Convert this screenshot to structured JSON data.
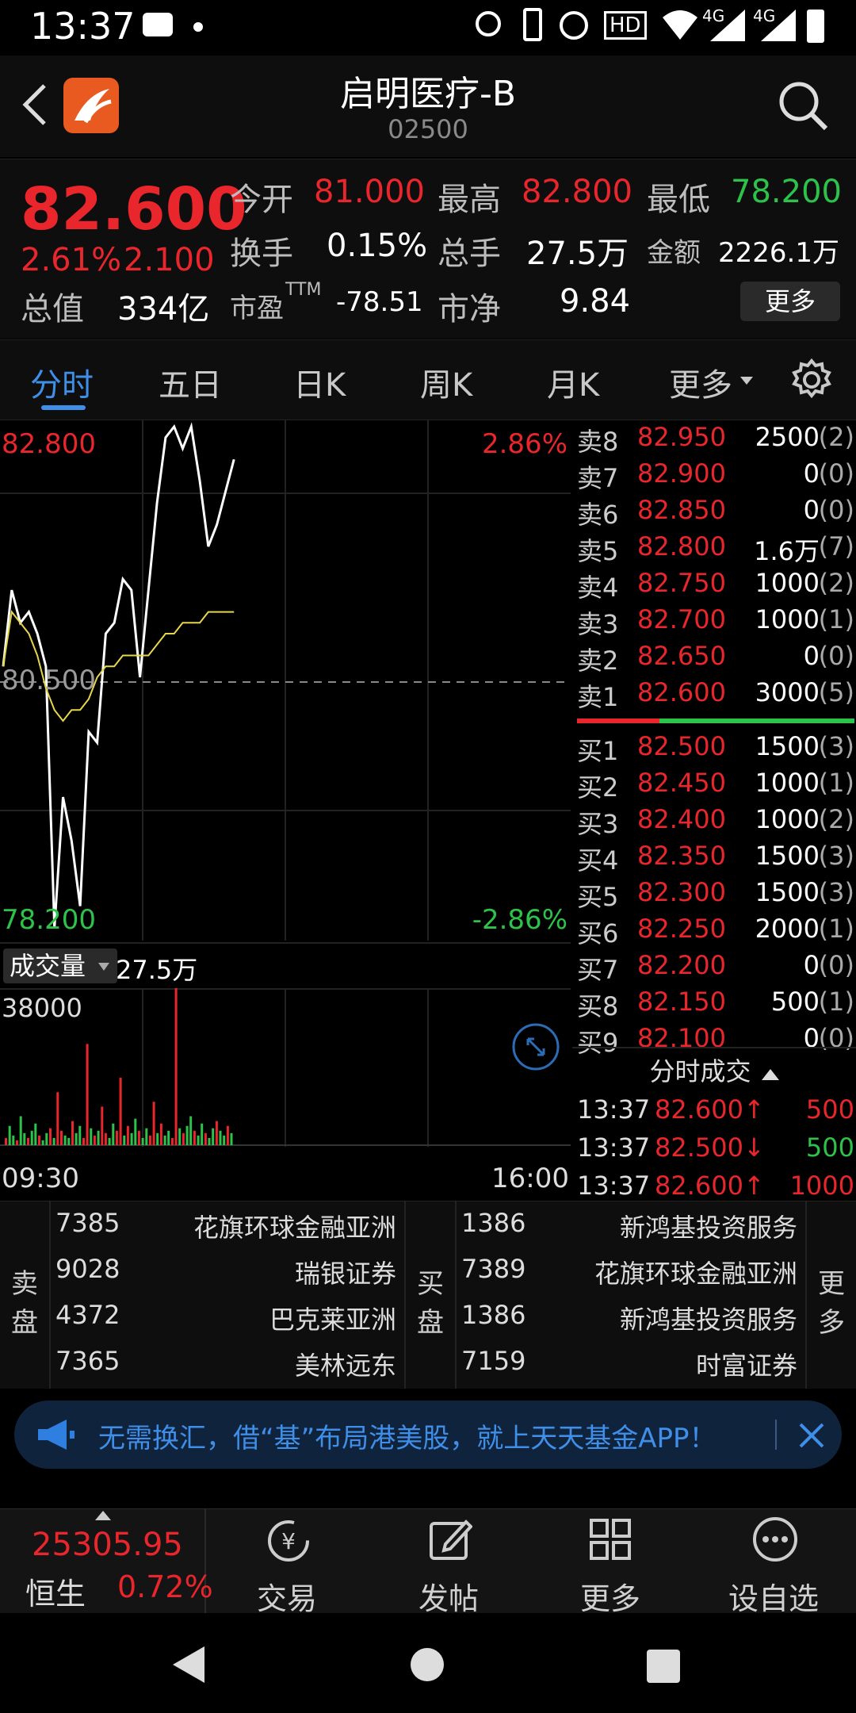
{
  "status_bar": {
    "time": "13:37",
    "network_1": "4G",
    "network_2": "4G"
  },
  "header": {
    "title": "启明医疗-B",
    "code": "02500"
  },
  "quote": {
    "price": "82.600",
    "change_pct": "2.61%",
    "change_abs": "2.100",
    "open_label": "今开",
    "open": "81.000",
    "high_label": "最高",
    "high": "82.800",
    "low_label": "最低",
    "low": "78.200",
    "turnover_label": "换手",
    "turnover": "0.15%",
    "volume_label": "总手",
    "volume": "27.5万",
    "amount_label": "金额",
    "amount": "2226.1万",
    "mcap_label": "总值",
    "mcap": "334亿",
    "pe_label": "市盈",
    "pe_sup": "TTM",
    "pe": "-78.51",
    "pb_label": "市净",
    "pb": "9.84",
    "more_button": "更多"
  },
  "tabs": [
    "分时",
    "五日",
    "日K",
    "周K",
    "月K",
    "更多"
  ],
  "chart": {
    "high_label": "82.800",
    "high_pct": "2.86%",
    "mid_label": "80.500",
    "low_label": "78.200",
    "low_pct": "-2.86%",
    "volume_selector": "成交量",
    "volume_total": "27.5万",
    "volume_max": "38000",
    "time_start": "09:30",
    "time_end": "16:00",
    "colors": {
      "price_line": "#ffffff",
      "avg_line": "#e8d64a",
      "up": "#e8262b",
      "down": "#2dc34a"
    }
  },
  "chart_data": {
    "type": "line",
    "title": "",
    "xlabel": "",
    "ylabel": "",
    "ylim": [
      78.2,
      82.8
    ],
    "x_range": [
      "09:30",
      "16:00"
    ],
    "series": [
      {
        "values": [
          80.6,
          81.3,
          81.0,
          81.1,
          80.9,
          80.6,
          78.2,
          79.4,
          79.0,
          78.4,
          80.0,
          79.9,
          80.9,
          81.0,
          81.4,
          81.3,
          80.5,
          81.3,
          82.1,
          82.7,
          82.8,
          82.6,
          82.8,
          82.3,
          81.7,
          81.9,
          82.2,
          82.5
        ]
      },
      {
        "values": [
          80.6,
          81.1,
          81.0,
          80.9,
          80.7,
          80.4,
          80.2,
          80.1,
          80.2,
          80.2,
          80.3,
          80.5,
          80.6,
          80.6,
          80.7,
          80.7,
          80.7,
          80.7,
          80.8,
          80.9,
          80.9,
          81.0,
          81.0,
          81.0,
          81.1,
          81.1,
          81.1,
          81.1
        ]
      }
    ]
  },
  "order_book": {
    "asks": [
      {
        "label": "卖8",
        "price": "82.950",
        "qty": "2500",
        "count": "(2)"
      },
      {
        "label": "卖7",
        "price": "82.900",
        "qty": "0",
        "count": "(0)"
      },
      {
        "label": "卖6",
        "price": "82.850",
        "qty": "0",
        "count": "(0)"
      },
      {
        "label": "卖5",
        "price": "82.800",
        "qty": "1.6万",
        "count": "(7)"
      },
      {
        "label": "卖4",
        "price": "82.750",
        "qty": "1000",
        "count": "(2)"
      },
      {
        "label": "卖3",
        "price": "82.700",
        "qty": "1000",
        "count": "(1)"
      },
      {
        "label": "卖2",
        "price": "82.650",
        "qty": "0",
        "count": "(0)"
      },
      {
        "label": "卖1",
        "price": "82.600",
        "qty": "3000",
        "count": "(5)"
      }
    ],
    "bids": [
      {
        "label": "买1",
        "price": "82.500",
        "qty": "1500",
        "count": "(3)"
      },
      {
        "label": "买2",
        "price": "82.450",
        "qty": "1000",
        "count": "(1)"
      },
      {
        "label": "买3",
        "price": "82.400",
        "qty": "1000",
        "count": "(2)"
      },
      {
        "label": "买4",
        "price": "82.350",
        "qty": "1500",
        "count": "(3)"
      },
      {
        "label": "买5",
        "price": "82.300",
        "qty": "1500",
        "count": "(3)"
      },
      {
        "label": "买6",
        "price": "82.250",
        "qty": "2000",
        "count": "(1)"
      },
      {
        "label": "买7",
        "price": "82.200",
        "qty": "0",
        "count": "(0)"
      },
      {
        "label": "买8",
        "price": "82.150",
        "qty": "500",
        "count": "(1)"
      },
      {
        "label": "买9",
        "price": "82.100",
        "qty": "0",
        "count": "(0)"
      }
    ],
    "trades_header": "分时成交",
    "trades": [
      {
        "time": "13:37",
        "price": "82.600↑",
        "qty": "500",
        "dir": "up"
      },
      {
        "time": "13:37",
        "price": "82.500↓",
        "qty": "500",
        "dir": "down"
      },
      {
        "time": "13:37",
        "price": "82.600↑",
        "qty": "1000",
        "dir": "up"
      }
    ]
  },
  "broker_queue": {
    "sell_label": "卖盘",
    "buy_label": "买盘",
    "more_label": "更多",
    "sell": [
      {
        "id": "7385",
        "name": "花旗环球金融亚洲"
      },
      {
        "id": "9028",
        "name": "瑞银证券"
      },
      {
        "id": "4372",
        "name": "巴克莱亚洲"
      },
      {
        "id": "7365",
        "name": "美林远东"
      }
    ],
    "buy": [
      {
        "id": "1386",
        "name": "新鸿基投资服务"
      },
      {
        "id": "7389",
        "name": "花旗环球金融亚洲"
      },
      {
        "id": "1386",
        "name": "新鸿基投资服务"
      },
      {
        "id": "7159",
        "name": "时富证券"
      }
    ]
  },
  "banner": {
    "text": "无需换汇，借“基”布局港美股，就上天天基金APP！"
  },
  "bottom_bar": {
    "index_value": "25305.95",
    "index_name": "恒生",
    "index_change": "0.72%",
    "items": [
      "交易",
      "发帖",
      "更多",
      "设自选"
    ]
  }
}
